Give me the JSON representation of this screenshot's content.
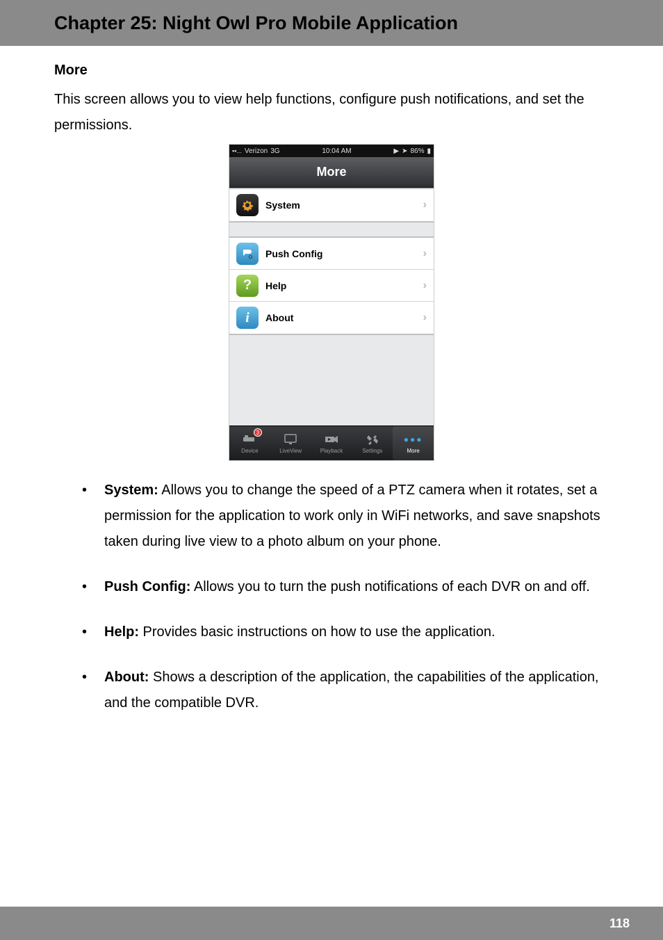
{
  "header": {
    "title": "Chapter 25: Night Owl Pro Mobile Application"
  },
  "section": {
    "heading": "More",
    "intro": "This screen allows you to view help functions, configure push notifications, and set the permissions."
  },
  "phone": {
    "status": {
      "carrier": "Verizon",
      "network": "3G",
      "time": "10:04 AM",
      "battery": "86%"
    },
    "nav_title": "More",
    "rows": [
      {
        "label": "System",
        "icon": "gear"
      },
      {
        "label": "Push Config",
        "icon": "push"
      },
      {
        "label": "Help",
        "icon": "help"
      },
      {
        "label": "About",
        "icon": "about"
      }
    ],
    "tabs": [
      {
        "label": "Device",
        "icon": "device",
        "badge": "3"
      },
      {
        "label": "LiveView",
        "icon": "monitor"
      },
      {
        "label": "Playback",
        "icon": "camera"
      },
      {
        "label": "Settings",
        "icon": "tools"
      },
      {
        "label": "More",
        "icon": "dots",
        "active": true
      }
    ]
  },
  "bullets": [
    {
      "title": "System:",
      "body": " Allows you to change the speed of a PTZ camera when it rotates, set a permission for the application to work only in WiFi networks, and save snapshots taken during live view to a photo album on your phone."
    },
    {
      "title": "Push Config:",
      "body": " Allows you to turn the push notifications of each DVR on and off."
    },
    {
      "title": "Help:",
      "body": " Provides basic instructions on how to use the application."
    },
    {
      "title": "About:",
      "body": " Shows a description of the application, the capabilities of the application, and the compatible DVR."
    }
  ],
  "footer": {
    "page": "118"
  }
}
